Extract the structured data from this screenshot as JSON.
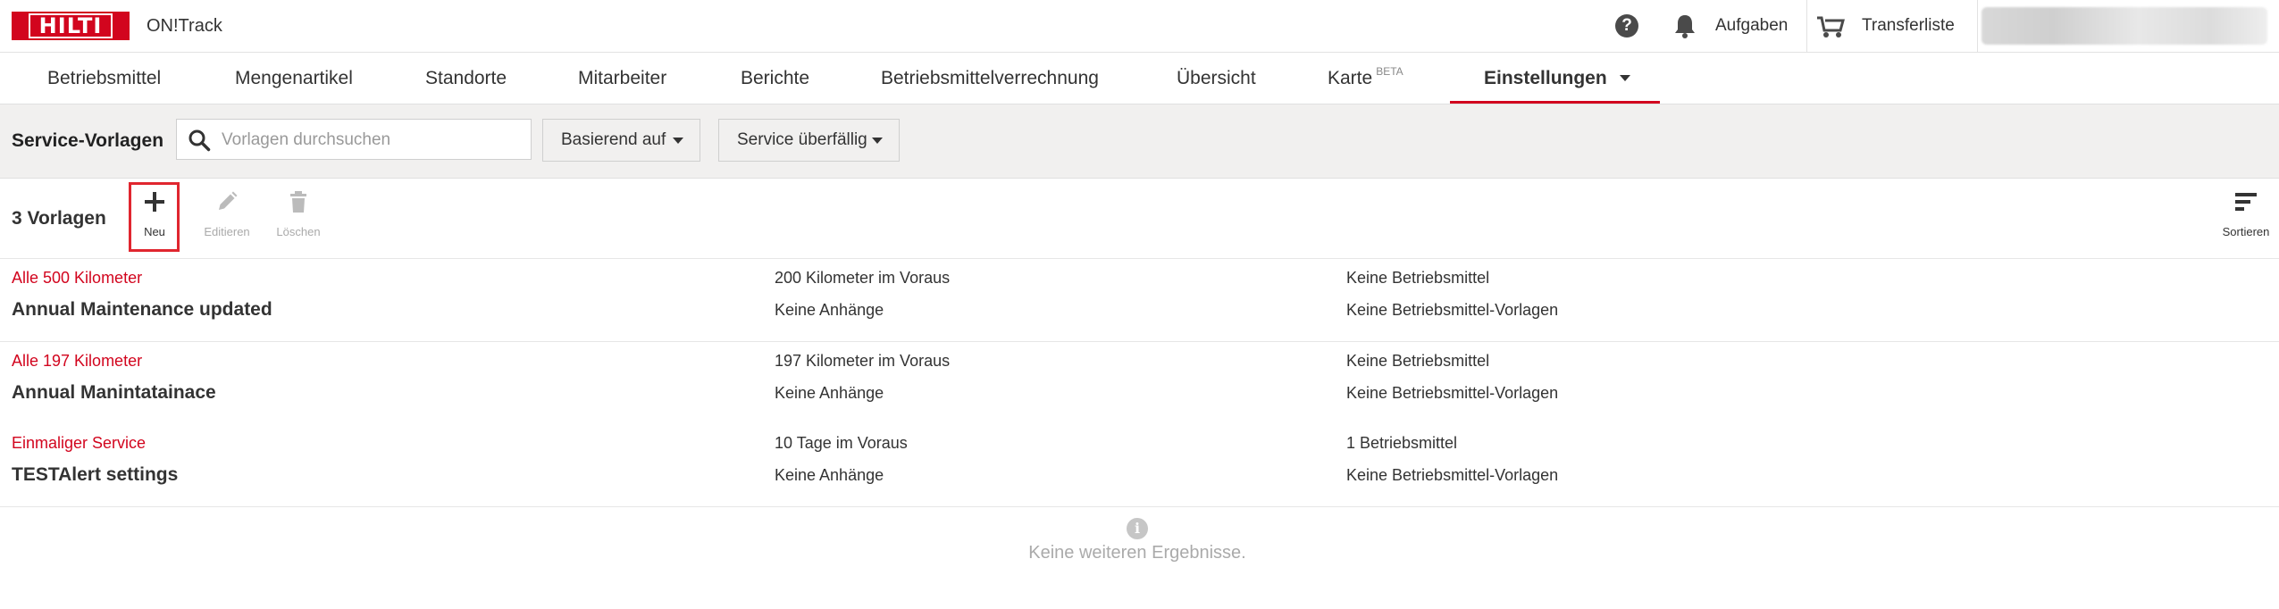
{
  "header": {
    "logo_text": "HILTI",
    "app_name": "ON!Track",
    "help_icon": "question-circle-icon",
    "tasks_label": "Aufgaben",
    "transfer_label": "Transferliste"
  },
  "nav": {
    "items": [
      {
        "label": "Betriebsmittel"
      },
      {
        "label": "Mengenartikel"
      },
      {
        "label": "Standorte"
      },
      {
        "label": "Mitarbeiter"
      },
      {
        "label": "Berichte"
      },
      {
        "label": "Betriebsmittelverrechnung"
      },
      {
        "label": "Übersicht"
      },
      {
        "label": "Karte",
        "badge": "BETA"
      },
      {
        "label": "Einstellungen"
      }
    ],
    "active": "Einstellungen",
    "accent_color": "#d2051e"
  },
  "filterbar": {
    "title": "Service-Vorlagen",
    "search_placeholder": "Vorlagen durchsuchen",
    "search_value": "",
    "based_on_label": "Basierend auf",
    "overdue_label": "Service überfällig"
  },
  "toolbar": {
    "count_label": "3 Vorlagen",
    "new_label": "Neu",
    "edit_label": "Editieren",
    "delete_label": "Löschen",
    "sort_label": "Sortieren"
  },
  "templates": [
    {
      "type": "Alle 500 Kilometer",
      "name": "Annual Maintenance updated",
      "advance": "200 Kilometer im Voraus",
      "attachments": "Keine Anhänge",
      "assets": "Keine Betriebsmittel",
      "asset_templates": "Keine Betriebsmittel-Vorlagen"
    },
    {
      "type": "Alle 197 Kilometer",
      "name": "Annual Manintatainace",
      "advance": "197 Kilometer im Voraus",
      "attachments": "Keine Anhänge",
      "assets": "Keine Betriebsmittel",
      "asset_templates": "Keine Betriebsmittel-Vorlagen"
    },
    {
      "type": "Einmaliger Service",
      "name": "TESTAlert settings",
      "advance": "10 Tage im Voraus",
      "attachments": "Keine Anhänge",
      "assets": "1 Betriebsmittel",
      "asset_templates": "Keine Betriebsmittel-Vorlagen"
    }
  ],
  "footer": {
    "no_more_results": "Keine weiteren Ergebnisse."
  }
}
